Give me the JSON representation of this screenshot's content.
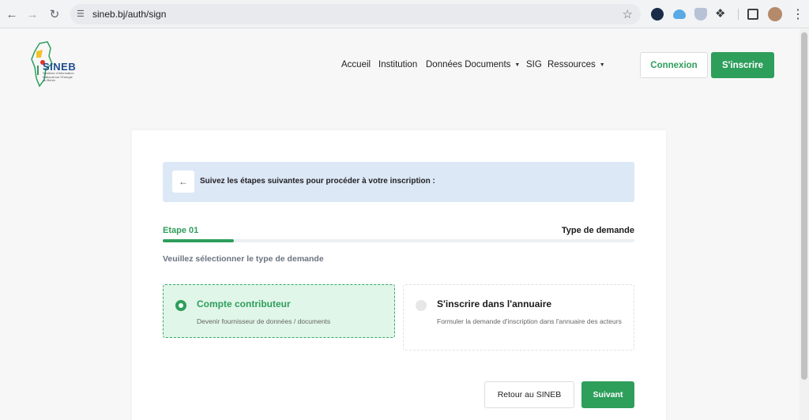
{
  "browser": {
    "url": "sineb.bj/auth/sign",
    "icons": [
      "back-arrow-icon",
      "forward-arrow-icon",
      "reload-icon",
      "site-settings-icon",
      "bookmark-star-icon",
      "extension-icon",
      "sidepanel-icon",
      "profile-avatar",
      "more-icon"
    ]
  },
  "header": {
    "logo_text": "SINEB",
    "logo_subtitle": "Système d'Information National sur l'Energie du Bénin",
    "nav": [
      {
        "label": "Accueil",
        "dropdown": false
      },
      {
        "label": "Institution",
        "dropdown": false
      },
      {
        "label": "Données Documents",
        "dropdown": true
      },
      {
        "label": "SIG",
        "dropdown": false
      },
      {
        "label": "Ressources",
        "dropdown": true
      }
    ],
    "login_label": "Connexion",
    "signup_label": "S'inscrire"
  },
  "form": {
    "banner_text": "Suivez les étapes suivantes pour procéder à votre inscription :",
    "step_label": "Etape 01",
    "step_title": "Type de demande",
    "progress_fraction": 0.15,
    "instruction": "Veuillez sélectionner le type de demande",
    "options": [
      {
        "title": "Compte contributeur",
        "description": "Devenir fournisseur de données / documents",
        "selected": true
      },
      {
        "title": "S'inscrire dans l'annuaire",
        "description": "Formuler la demande d'inscription dans l'annuaire des acteurs",
        "selected": false
      }
    ],
    "back_button": "Retour au SINEB",
    "next_button": "Suivant"
  },
  "colors": {
    "accent": "#2e9e5b",
    "banner_bg": "#dde8f7",
    "selected_bg": "#e0f6e8"
  }
}
